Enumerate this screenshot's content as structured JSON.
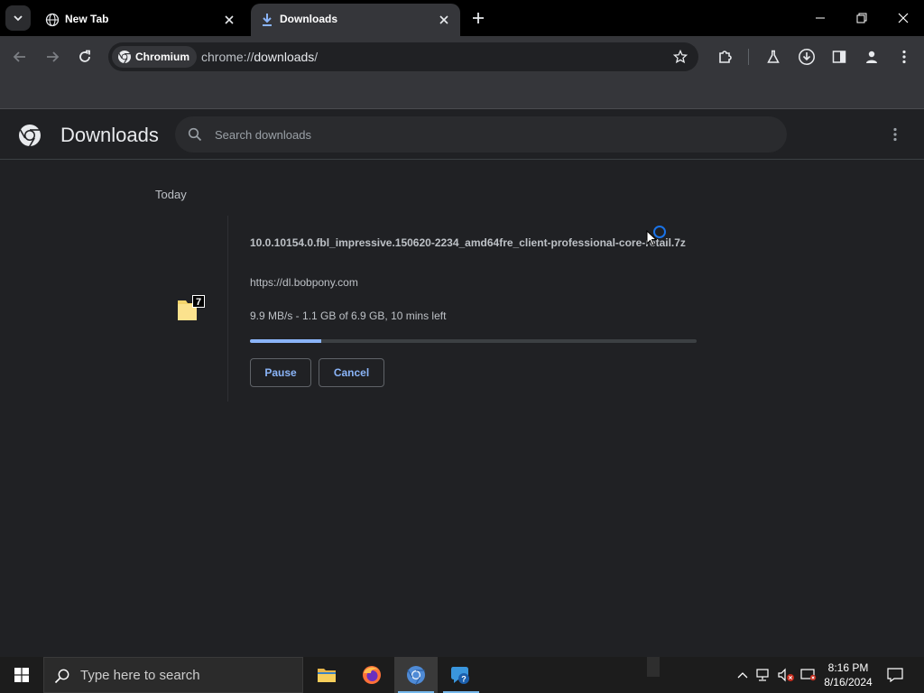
{
  "browser": {
    "tabs": [
      {
        "title": "New Tab",
        "active": false
      },
      {
        "title": "Downloads",
        "active": true
      }
    ],
    "chip_label": "Chromium",
    "url_scheme": "chrome://",
    "url_host": "downloads",
    "url_path": "/"
  },
  "page": {
    "title": "Downloads",
    "search_placeholder": "Search downloads",
    "date_header": "Today"
  },
  "download": {
    "filename": "10.0.10154.0.fbl_impressive.150620-2234_amd64fre_client-professional-core-retail.7z",
    "source_url": "https://dl.bobpony.com",
    "status": "9.9 MB/s - 1.1 GB of 6.9 GB, 10 mins left",
    "progress_fraction": 0.16,
    "pause_label": "Pause",
    "cancel_label": "Cancel"
  },
  "taskbar": {
    "search_placeholder": "Type here to search",
    "time": "8:16 PM",
    "date": "8/16/2024"
  },
  "colors": {
    "accent": "#8ab4f8",
    "background": "#202124",
    "toolbar": "#35363a"
  }
}
